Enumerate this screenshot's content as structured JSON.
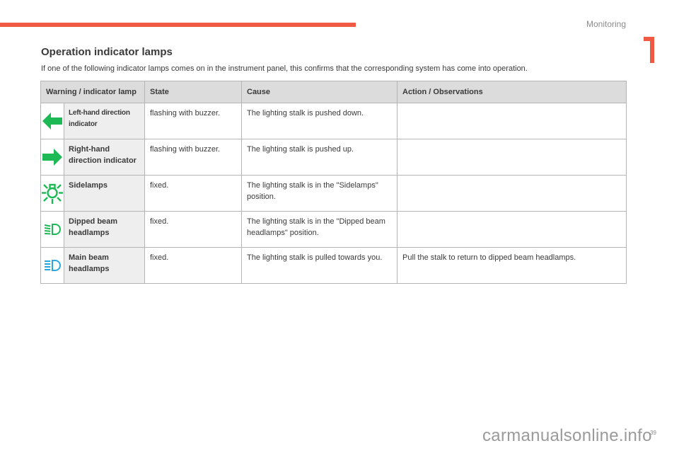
{
  "header": {
    "section": "Monitoring",
    "chapter": "1",
    "accent_color": "#f15a42"
  },
  "title": "Operation indicator lamps",
  "intro": "If one of the following indicator lamps comes on in the instrument panel, this confirms that the corresponding system has come into operation.",
  "table": {
    "headers": [
      "Warning / indicator lamp",
      "State",
      "Cause",
      "Action / Observations"
    ],
    "rows": [
      {
        "icon": "left-arrow-icon",
        "icon_color": "#1db954",
        "name": "Left-hand direction indicator",
        "state": "flashing with buzzer.",
        "cause": "The lighting stalk is pushed down.",
        "action": ""
      },
      {
        "icon": "right-arrow-icon",
        "icon_color": "#1db954",
        "name": "Right-hand direction indicator",
        "state": "flashing with buzzer.",
        "cause": "The lighting stalk is pushed up.",
        "action": ""
      },
      {
        "icon": "sidelamps-icon",
        "icon_color": "#1db954",
        "name": "Sidelamps",
        "state": "fixed.",
        "cause": "The lighting stalk is in the \"Sidelamps\" position.",
        "action": ""
      },
      {
        "icon": "dipped-beam-icon",
        "icon_color": "#1db954",
        "name": "Dipped beam headlamps",
        "state": "fixed.",
        "cause": "The lighting stalk is in the \"Dipped beam headlamps\" position.",
        "action": ""
      },
      {
        "icon": "main-beam-icon",
        "icon_color": "#29a8e0",
        "name": "Main beam headlamps",
        "state": "fixed.",
        "cause": "The lighting stalk is pulled towards you.",
        "action": "Pull the stalk to return to dipped beam headlamps."
      }
    ]
  },
  "footer": {
    "page_number": "39",
    "watermark": "carmanualsonline.info"
  }
}
